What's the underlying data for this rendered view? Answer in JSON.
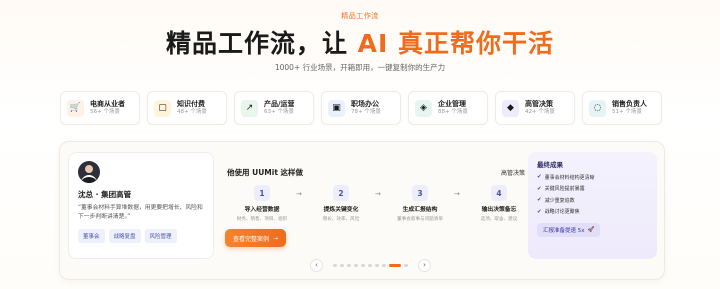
{
  "hero": {
    "eyebrow": "精品工作流",
    "headline_main": "精品工作流，让 ",
    "headline_accent": "AI 真正帮你干活",
    "subtitle": "1000+ 行业场景，开箱即用，一键复制你的生产力"
  },
  "categories": [
    {
      "icon": "cart-icon",
      "glyph": "🛒",
      "bg": "#fff1e6",
      "title": "电商从业者",
      "count": "56+ 个场景"
    },
    {
      "icon": "receipt-icon",
      "glyph": "▢",
      "bg": "#fff5dc",
      "title": "知识付费",
      "count": "48+ 个场景"
    },
    {
      "icon": "trend-icon",
      "glyph": "↗",
      "bg": "#e8f6ec",
      "title": "产品/运营",
      "count": "63+ 个场景"
    },
    {
      "icon": "office-icon",
      "glyph": "▣",
      "bg": "#eaf0fd",
      "title": "职场办公",
      "count": "78+ 个场景"
    },
    {
      "icon": "manage-icon",
      "glyph": "◈",
      "bg": "#e6f5f0",
      "title": "企业管理",
      "count": "88+ 个场景"
    },
    {
      "icon": "diamond-icon",
      "glyph": "◆",
      "bg": "#eeebfc",
      "title": "高管决策",
      "count": "42+ 个场景"
    },
    {
      "icon": "chat-icon",
      "glyph": "◌",
      "bg": "#e6f4f7",
      "title": "销售负责人",
      "count": "51+ 个场景"
    }
  ],
  "persona": {
    "name": "沈总 · 集团高管",
    "quote": "“董事会材料手算堆数据，用更要把增长、风险和下一步判断讲清楚。”",
    "tags": [
      "董事会",
      "战略复盘",
      "风险管理"
    ]
  },
  "flow": {
    "title": "他使用 UUMit 这样做",
    "link": "高管决策",
    "steps": [
      {
        "num": "1",
        "title": "导入经营数据",
        "desc": "财务、销售、项目、组织"
      },
      {
        "num": "2",
        "title": "提炼关键变化",
        "desc": "增长、效率、风险"
      },
      {
        "num": "3",
        "title": "生成汇报结构",
        "desc": "董事会叙事与问题清单"
      },
      {
        "num": "4",
        "title": "输出决策备忘",
        "desc": "选项、取舍、建议"
      }
    ],
    "cta": "查看完整案例",
    "cta_icon": "arrow-right-icon"
  },
  "results": {
    "title": "最终成果",
    "items": [
      "董事会材料结构更清晰",
      "关键风险提前暴露",
      "减少重复追数",
      "战略讨论更聚焦"
    ],
    "badge": "汇报准备提速 5x",
    "badge_icon": "rocket-icon"
  },
  "pager": {
    "prev": "‹",
    "next": "›",
    "total": 10,
    "active": 8
  }
}
